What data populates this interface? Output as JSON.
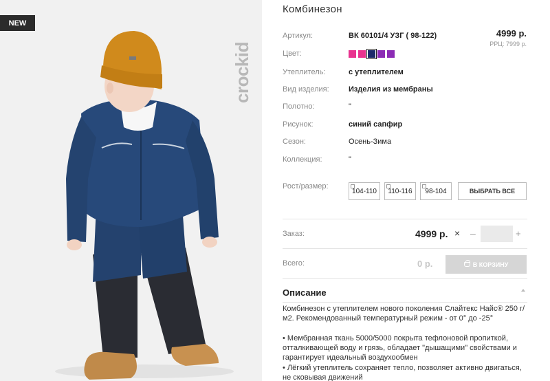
{
  "photo": {
    "badge": "NEW",
    "brand": "crockid"
  },
  "product": {
    "title": "Комбинезон",
    "price": "4999 р.",
    "rrp": "РРЦ: 7999 р.",
    "specs": [
      {
        "label": "Артикул:",
        "value": "ВК 60101/4 УЗГ ( 98-122)",
        "bold": true
      },
      {
        "label": "Цвет:",
        "value": "",
        "bold": false
      },
      {
        "label": "Утеплитель:",
        "value": "с утеплителем",
        "bold": true
      },
      {
        "label": "Вид изделия:",
        "value": "Изделия из мембраны",
        "bold": true
      },
      {
        "label": "Полотно:",
        "value": "\"",
        "bold": false
      },
      {
        "label": "Рисунок:",
        "value": "синий сапфир",
        "bold": true
      },
      {
        "label": "Сезон:",
        "value": "Осень-Зима",
        "bold": false
      },
      {
        "label": "Коллекция:",
        "value": "\"",
        "bold": false
      },
      {
        "label": "Рост/размер:",
        "value": "",
        "bold": false
      }
    ],
    "colors": [
      "#e8338f",
      "#e8338f",
      "#1c2a6b",
      "#8c2bb5",
      "#8c2bb5"
    ],
    "selected_color_index": 2,
    "sizes": [
      "104-110",
      "110-116",
      "98-104"
    ],
    "select_all": "ВЫБРАТЬ ВСЕ"
  },
  "order": {
    "label": "Заказ:",
    "price": "4999 р.",
    "times": "×",
    "minus": "–",
    "plus": "+",
    "qty": ""
  },
  "total": {
    "label": "Всего:",
    "value": "0 р.",
    "cart_button": "В КОРЗИНУ"
  },
  "description": {
    "title": "Описание",
    "paragraphs": [
      "Комбинезон с утеплителем нового поколения Слайтекс Найс® 250 г/м2. Рекомендованный температурный режим - от 0° до -25°",
      "• Мембранная ткань 5000/5000 покрыта тефлоновой пропиткой, отталкивающей воду и грязь, обладает \"дышащими\" свойствами и гарантирует идеальный воздухообмен",
      "• Лёгкий утеплитель сохраняет тепло, позволяет активно двигаться, не сковывая движений"
    ]
  }
}
